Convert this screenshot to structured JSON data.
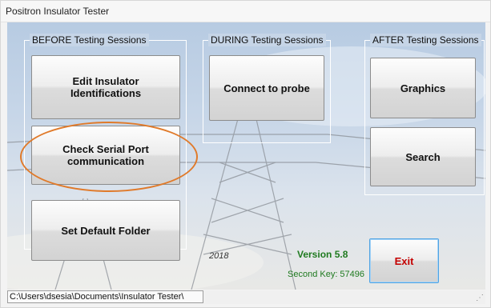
{
  "window": {
    "title": "Positron Insulator Tester"
  },
  "groups": {
    "before": {
      "title": "BEFORE Testing Sessions",
      "buttons": {
        "edit": "Edit Insulator Identifications",
        "serial": "Check Serial Port communication",
        "folder": "Set Default Folder"
      }
    },
    "during": {
      "title": "DURING Testing Sessions",
      "buttons": {
        "connect": "Connect to probe"
      }
    },
    "after": {
      "title": "AFTER Testing Sessions",
      "buttons": {
        "graphics": "Graphics",
        "search": "Search"
      }
    }
  },
  "info": {
    "year": "2018",
    "version": "Version 5.8",
    "second_key": "Second Key: 57496"
  },
  "exit_label": "Exit",
  "status": {
    "path": "C:\\Users\\dsesia\\Documents\\Insulator Tester\\"
  },
  "colors": {
    "highlight": "#e07a2a",
    "version_text": "#1f7a1f",
    "exit_text": "#c40000"
  }
}
